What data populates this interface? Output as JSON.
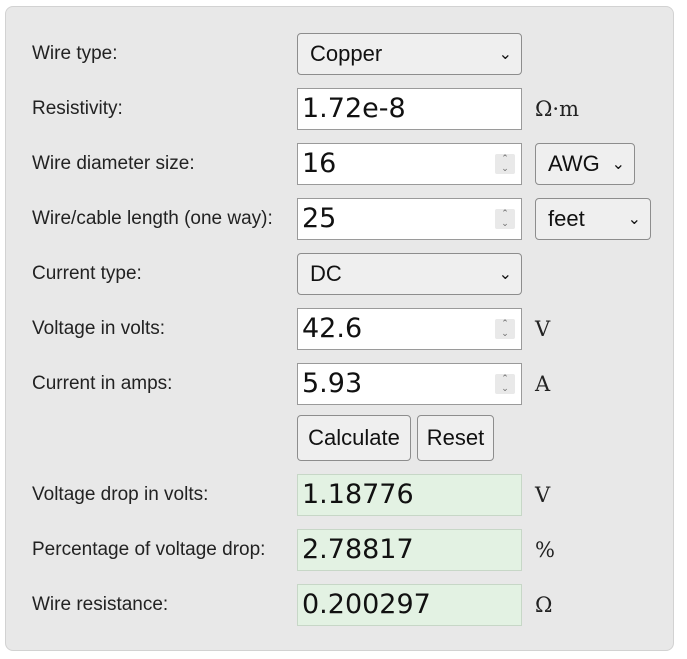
{
  "wire_type": {
    "label": "Wire type:",
    "value": "Copper"
  },
  "resistivity": {
    "label": "Resistivity:",
    "value": "1.72e-8",
    "unit": "Ω·m"
  },
  "wire_diameter": {
    "label": "Wire diameter size:",
    "value": "16",
    "unit": "AWG"
  },
  "wire_length": {
    "label": "Wire/cable length (one way):",
    "value": "25",
    "unit": "feet"
  },
  "current_type": {
    "label": "Current type:",
    "value": "DC"
  },
  "voltage": {
    "label": "Voltage in volts:",
    "value": "42.6",
    "unit": "V"
  },
  "current": {
    "label": "Current in amps:",
    "value": "5.93",
    "unit": "A"
  },
  "buttons": {
    "calculate": "Calculate",
    "reset": "Reset"
  },
  "results": {
    "voltage_drop": {
      "label": "Voltage drop in volts:",
      "value": "1.18776",
      "unit": "V"
    },
    "percentage_drop": {
      "label": "Percentage of voltage drop:",
      "value": "2.78817",
      "unit": "%"
    },
    "wire_resistance": {
      "label": "Wire resistance:",
      "value": "0.200297",
      "unit": "Ω"
    }
  },
  "icons": {
    "dropdown": "chevron-down-icon",
    "spinner": "spinner-arrows-icon"
  },
  "colors": {
    "panel_bg": "#e8e8e8",
    "result_bg": "#e3f2e3",
    "input_bg": "#ffffff"
  }
}
